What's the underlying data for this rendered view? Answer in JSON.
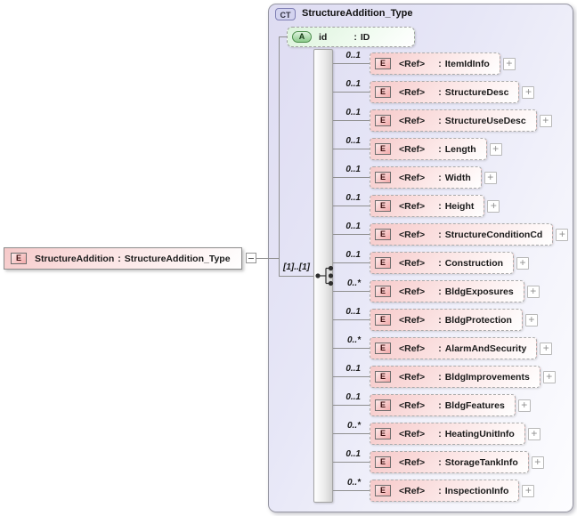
{
  "diagram": {
    "root_element": {
      "badge": "E",
      "name": "StructureAddition",
      "separator": ":",
      "type": "StructureAddition_Type"
    },
    "complex_type": {
      "badge": "CT",
      "title": "StructureAddition_Type",
      "attribute": {
        "badge": "A",
        "name": "id",
        "separator": ":",
        "type": "ID"
      },
      "group": {
        "compositor": "sequence",
        "cardinality": "[1]..[1]"
      },
      "element_badge": "E",
      "ref_label": "<Ref>",
      "separator": ":",
      "expand_label": "+",
      "elements": [
        {
          "type": "ItemIdInfo",
          "cardinality": "0..1"
        },
        {
          "type": "StructureDesc",
          "cardinality": "0..1"
        },
        {
          "type": "StructureUseDesc",
          "cardinality": "0..1"
        },
        {
          "type": "Length",
          "cardinality": "0..1"
        },
        {
          "type": "Width",
          "cardinality": "0..1"
        },
        {
          "type": "Height",
          "cardinality": "0..1"
        },
        {
          "type": "StructureConditionCd",
          "cardinality": "0..1"
        },
        {
          "type": "Construction",
          "cardinality": "0..1"
        },
        {
          "type": "BldgExposures",
          "cardinality": "0..*"
        },
        {
          "type": "BldgProtection",
          "cardinality": "0..1"
        },
        {
          "type": "AlarmAndSecurity",
          "cardinality": "0..*"
        },
        {
          "type": "BldgImprovements",
          "cardinality": "0..1"
        },
        {
          "type": "BldgFeatures",
          "cardinality": "0..1"
        },
        {
          "type": "HeatingUnitInfo",
          "cardinality": "0..*"
        },
        {
          "type": "StorageTankInfo",
          "cardinality": "0..1"
        },
        {
          "type": "InspectionInfo",
          "cardinality": "0..*"
        }
      ]
    },
    "colors": {
      "element_fill": "#f6c9c9",
      "attribute_fill": "#dcf3dc",
      "container_fill": "#e2e2f4",
      "line": "#8f8f8f"
    }
  }
}
